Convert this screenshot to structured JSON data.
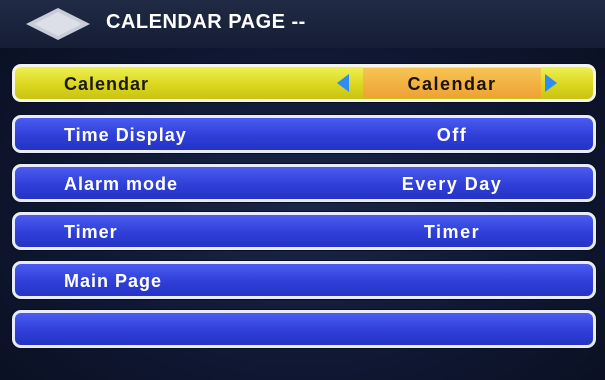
{
  "header": {
    "title": "CALENDAR PAGE --",
    "icon": "diamond-icon"
  },
  "menu": {
    "items": [
      {
        "label": "Calendar",
        "value": "Calendar",
        "selected": true
      },
      {
        "label": "Time Display",
        "value": "Off",
        "selected": false
      },
      {
        "label": "Alarm mode",
        "value": "Every Day",
        "selected": false
      },
      {
        "label": "Timer",
        "value": "Timer",
        "selected": false
      },
      {
        "label": "Main Page",
        "value": "",
        "selected": false
      },
      {
        "label": "",
        "value": "",
        "selected": false
      }
    ]
  },
  "colors": {
    "selected_row": "#d9d41c",
    "row": "#2f3fd8",
    "value_highlight": "#eea235",
    "arrow": "#2e8cf2"
  }
}
